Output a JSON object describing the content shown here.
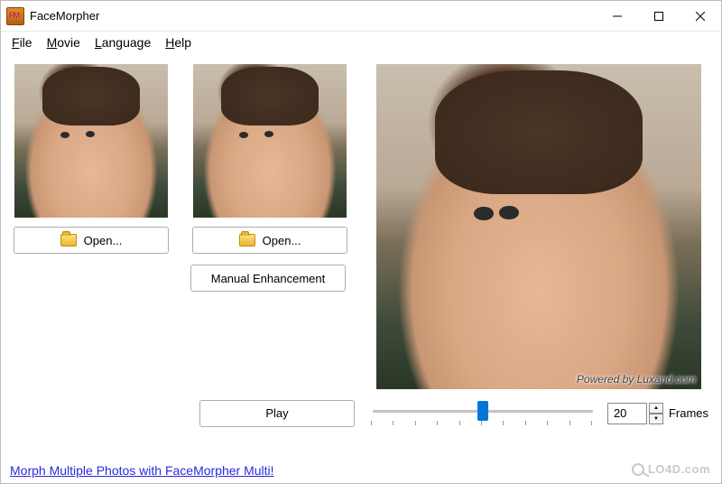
{
  "window": {
    "title": "FaceMorpher"
  },
  "menu": {
    "file": "File",
    "movie": "Movie",
    "language": "Language",
    "help": "Help"
  },
  "buttons": {
    "open": "Open...",
    "manual_enhancement": "Manual Enhancement",
    "play": "Play"
  },
  "frames": {
    "value": "20",
    "label": "Frames"
  },
  "slider": {
    "value": 50,
    "min": 0,
    "max": 100
  },
  "watermark": "Powered by Luxand.com",
  "footer_link": "Morph Multiple Photos with FaceMorpher Multi!",
  "branding": "LO4D.com"
}
